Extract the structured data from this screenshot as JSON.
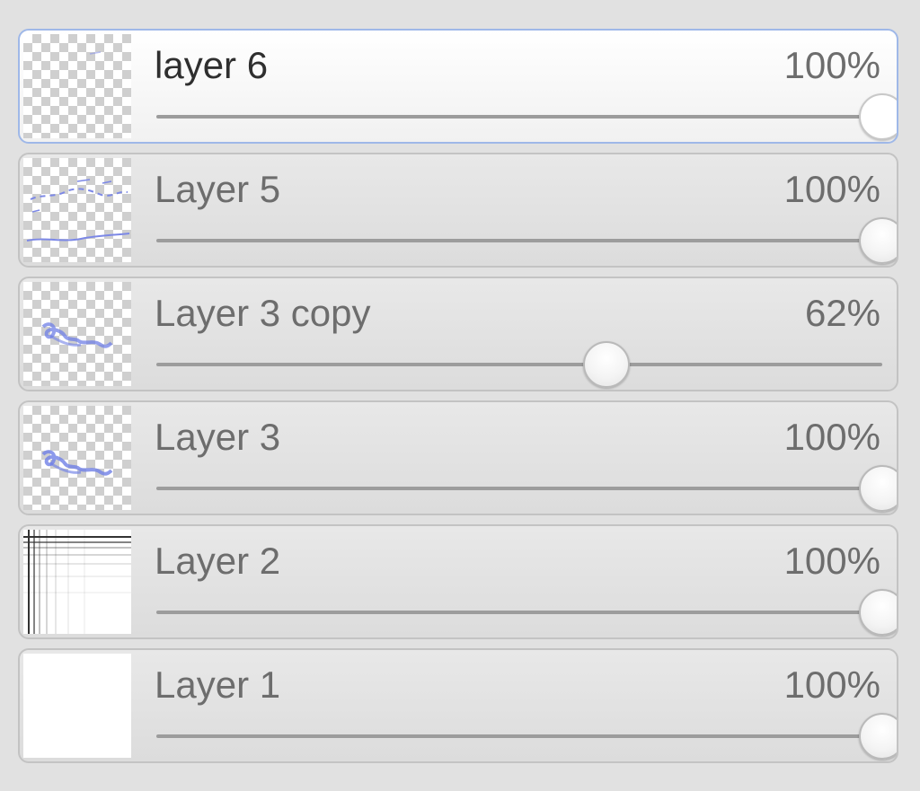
{
  "layers_panel": {
    "layers": [
      {
        "name": "layer 6",
        "opacity_label": "100%",
        "opacity": 1.0,
        "selected": true,
        "thumbnail": "transparent"
      },
      {
        "name": "Layer 5",
        "opacity_label": "100%",
        "opacity": 1.0,
        "selected": false,
        "thumbnail": "transparent-with-blue-strokes"
      },
      {
        "name": "Layer 3 copy",
        "opacity_label": "62%",
        "opacity": 0.62,
        "selected": false,
        "thumbnail": "transparent-with-blue-scribble"
      },
      {
        "name": "Layer 3",
        "opacity_label": "100%",
        "opacity": 1.0,
        "selected": false,
        "thumbnail": "transparent-with-blue-scribble"
      },
      {
        "name": "Layer 2",
        "opacity_label": "100%",
        "opacity": 1.0,
        "selected": false,
        "thumbnail": "grid-lines"
      },
      {
        "name": "Layer 1",
        "opacity_label": "100%",
        "opacity": 1.0,
        "selected": false,
        "thumbnail": "white-fill"
      }
    ]
  },
  "colors": {
    "panel_bg": "#e1e1e1",
    "selected_border": "#9fb8e8",
    "stroke_blue": "#6f7fe6"
  }
}
